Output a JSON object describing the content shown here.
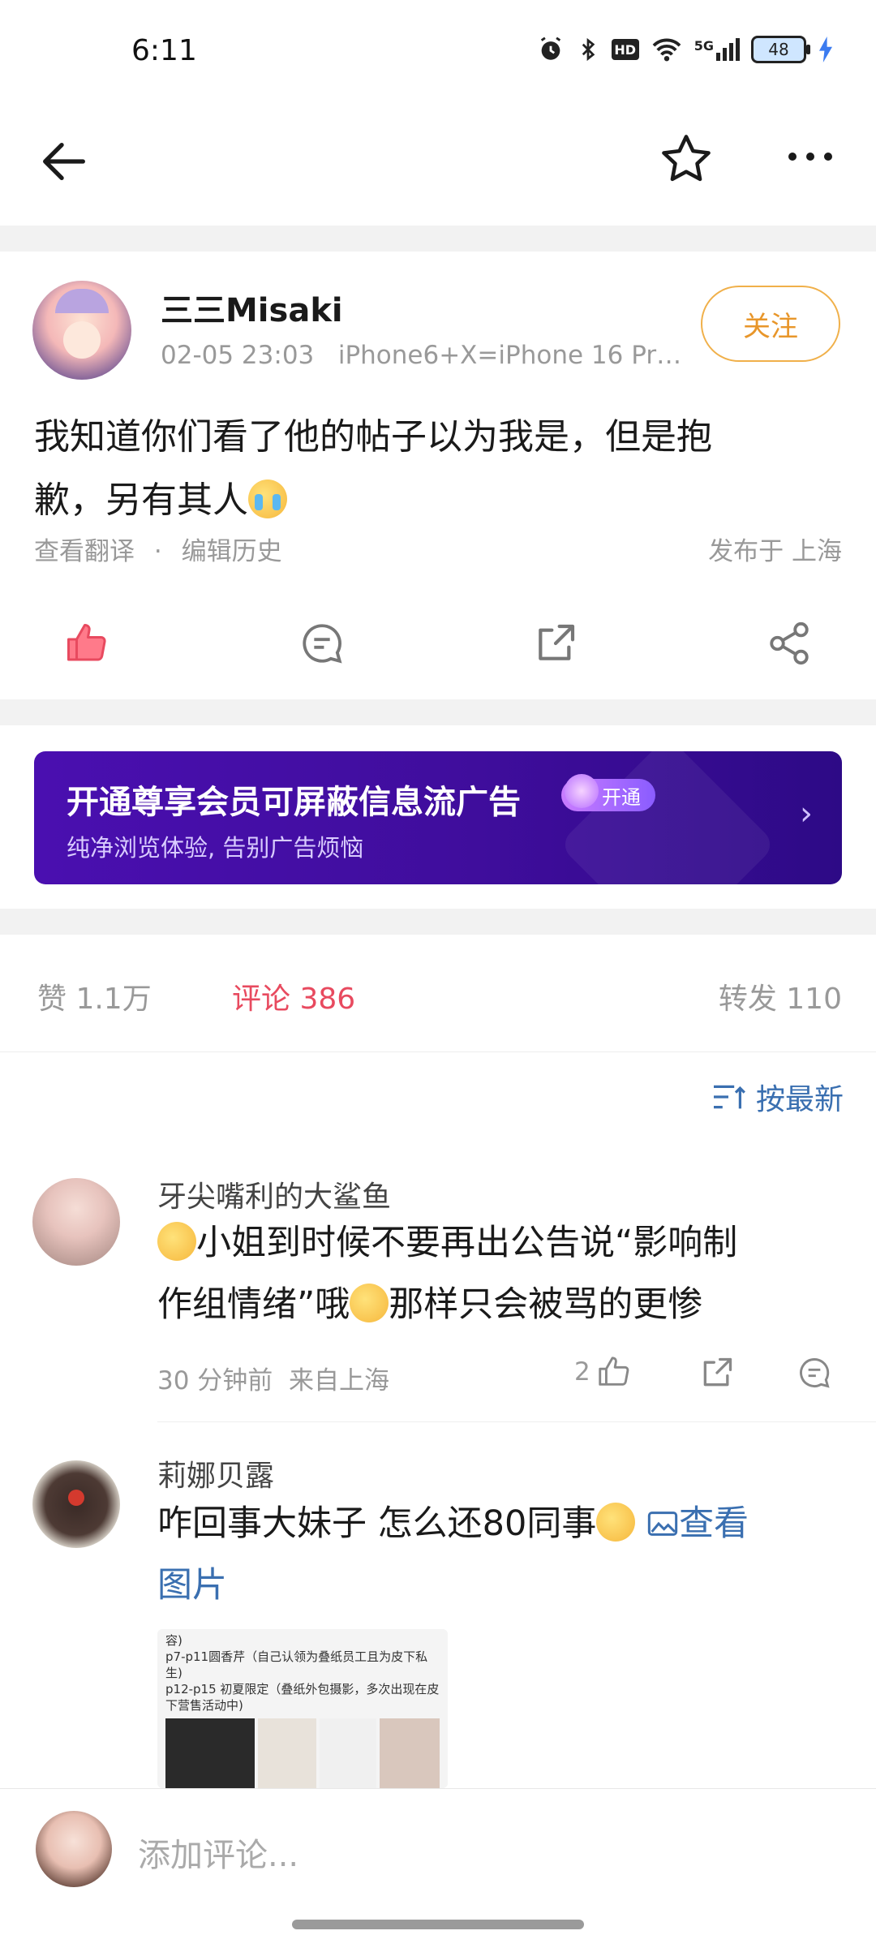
{
  "status": {
    "time": "6:11",
    "battery": "48",
    "network": "5G"
  },
  "nav": {
    "back_icon": "back-arrow-icon",
    "star_icon": "star-outline-icon",
    "more_icon": "more-horizontal-icon"
  },
  "post": {
    "author": "三三Misaki",
    "date": "02-05 23:03",
    "device": "iPhone6+X=iPhone 16 Pr…",
    "follow_label": "关注",
    "text_line1": "我知道你们看了他的帖子以为我是，但是抱",
    "text_line2": "歉，另有其人",
    "view_translation": "查看翻译",
    "sep": "·",
    "edit_history": "编辑历史",
    "location": "发布于 上海"
  },
  "banner": {
    "title": "开通尊享会员可屏蔽信息流广告",
    "pill": "开通",
    "subtitle": "纯净浏览体验, 告别广告烦恼"
  },
  "stats": {
    "likes": "赞 1.1万",
    "comments": "评论 386",
    "reposts": "转发 110"
  },
  "sort": {
    "label": "按最新"
  },
  "comments": [
    {
      "name": "牙尖嘴利的大鲨鱼",
      "line1": "小姐到时候不要再出公告说“影响制",
      "line2_a": "作组情绪”哦",
      "line2_b": "那样只会被骂的更惨",
      "time": "30 分钟前",
      "loc": "来自上海",
      "likes": "2"
    },
    {
      "name": "莉娜贝露",
      "line1": "咋回事大妹子 怎么还80同事",
      "link1": "查看",
      "link2": "图片",
      "thumb_lines": [
        "容)",
        "p7-p11圆香芹（自己认领为叠纸员工且为皮下私",
        "生)",
        "p12-p15 初夏限定（叠纸外包摄影，多次出现在皮",
        "下营售活动中)"
      ]
    }
  ],
  "input": {
    "placeholder": "添加评论..."
  },
  "colors": {
    "accent_red": "#e84a5f",
    "follow_orange": "#e8962a",
    "link_blue": "#3a6fb0",
    "banner_purple": "#4a0fb0"
  }
}
